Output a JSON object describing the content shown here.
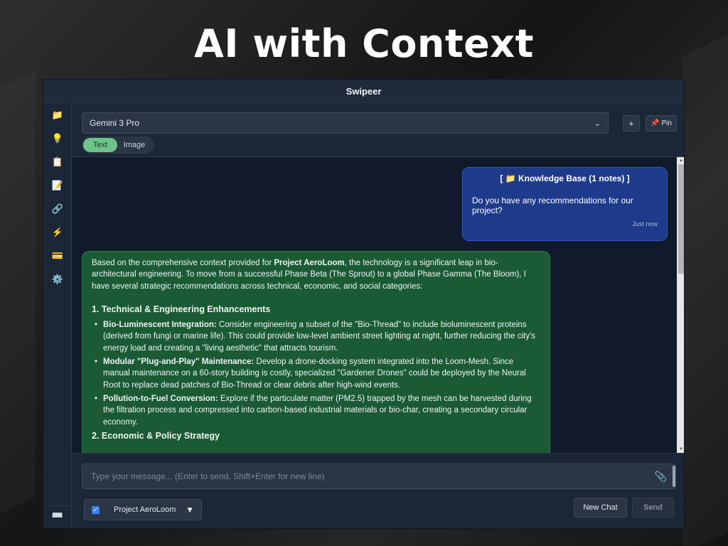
{
  "headline": "AI with Context",
  "window": {
    "title": "Swipeer"
  },
  "sidebar": {
    "items": [
      {
        "icon": "📁",
        "name": "folder-icon"
      },
      {
        "icon": "💡",
        "name": "lightbulb-icon"
      },
      {
        "icon": "📋",
        "name": "clipboard-icon"
      },
      {
        "icon": "📝",
        "name": "memo-icon"
      },
      {
        "icon": "🔗",
        "name": "link-icon"
      },
      {
        "icon": "⚡",
        "name": "lightning-icon"
      },
      {
        "icon": "💳",
        "name": "card-icon"
      },
      {
        "icon": "⚙️",
        "name": "gear-icon"
      }
    ],
    "bottom_icon": "⌨️"
  },
  "toolbar": {
    "model": "Gemini 3 Pro",
    "add_label": "+",
    "pin_icon": "📌",
    "pin_label": "Pin",
    "modes": [
      "Text",
      "Image"
    ]
  },
  "chat": {
    "user_message": {
      "kb_prefix": "[",
      "kb_icon": "📁",
      "kb_label": "Knowledge Base (1 notes)",
      "kb_suffix": "]",
      "text": "Do you have any recommendations for our project?",
      "timestamp": "Just now"
    },
    "ai_message": {
      "intro_before": "Based on the comprehensive context provided for ",
      "intro_bold": "Project AeroLoom",
      "intro_after": ", the technology is a significant leap in bio-architectural engineering. To move from a successful Phase Beta (The Sprout) to a global Phase Gamma (The Bloom), I have several strategic recommendations across technical, economic, and social categories:",
      "section1_title": "1. Technical & Engineering Enhancements",
      "bullets": [
        {
          "title": "Bio-Luminescent Integration:",
          "text": " Consider engineering a subset of the \"Bio-Thread\" to include bioluminescent proteins (derived from fungi or marine life). This could provide low-level ambient street lighting at night, further reducing the city's energy load and creating a \"living aesthetic\" that attracts tourism."
        },
        {
          "title": "Modular \"Plug-and-Play\" Maintenance:",
          "text": " Develop a drone-docking system integrated into the Loom-Mesh. Since manual maintenance on a 60-story building is costly, specialized \"Gardener Drones\" could be deployed by the Neural Root to replace dead patches of Bio-Thread or clear debris after high-wind events."
        },
        {
          "title": "Pollution-to-Fuel Conversion:",
          "text": " Explore if the particulate matter (PM2.5) trapped by the mesh can be harvested during the filtration process and compressed into carbon-based industrial materials or bio-char, creating a secondary circular economy."
        }
      ],
      "section2_title": "2. Economic & Policy Strategy"
    }
  },
  "composer": {
    "placeholder": "Type your message... (Enter to send, Shift+Enter for new line)",
    "attach_icon": "📎",
    "kb_checked": "✓",
    "kb_name": "Project AeroLoom",
    "kb_dropdown": "▼",
    "new_chat_label": "New Chat",
    "send_label": "Send"
  }
}
